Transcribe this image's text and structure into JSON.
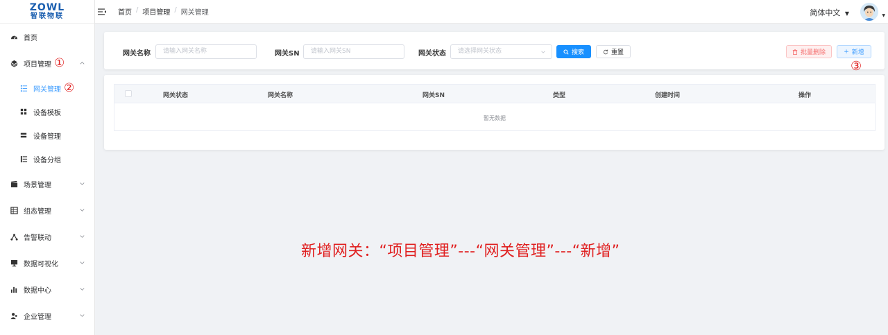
{
  "logo": {
    "main": "ZOWL",
    "sub": "智联物联"
  },
  "sidebar": {
    "items": [
      {
        "label": "首页",
        "icon": "dashboard-icon"
      },
      {
        "label": "项目管理",
        "icon": "layers-icon",
        "annotation": "①"
      },
      {
        "label": "网关管理",
        "icon": "list-icon",
        "annotation": "②"
      },
      {
        "label": "设备模板",
        "icon": "grid-icon"
      },
      {
        "label": "设备管理",
        "icon": "server-icon"
      },
      {
        "label": "设备分组",
        "icon": "group-icon"
      },
      {
        "label": "场景管理",
        "icon": "clapper-icon"
      },
      {
        "label": "组态管理",
        "icon": "table-icon"
      },
      {
        "label": "告警联动",
        "icon": "link-icon"
      },
      {
        "label": "数据可视化",
        "icon": "monitor-icon"
      },
      {
        "label": "数据中心",
        "icon": "bar-chart-icon"
      },
      {
        "label": "企业管理",
        "icon": "users-icon"
      }
    ]
  },
  "header": {
    "breadcrumb": [
      "首页",
      "项目管理",
      "网关管理"
    ],
    "separator": "/",
    "language": "简体中文"
  },
  "search": {
    "name_label": "网关名称",
    "name_placeholder": "请输入网关名称",
    "sn_label": "网关SN",
    "sn_placeholder": "请输入网关SN",
    "status_label": "网关状态",
    "status_placeholder": "请选择网关状态",
    "search_button": "搜索",
    "reset_button": "重置",
    "batch_delete_button": "批量删除",
    "add_button": "新增",
    "add_annotation": "③"
  },
  "table": {
    "columns": [
      "网关状态",
      "网关名称",
      "网关SN",
      "类型",
      "创建时间",
      "操作"
    ],
    "empty_text": "暂无数据"
  },
  "annotation": {
    "text": "新增网关：“项目管理”---“网关管理”---“新增”"
  },
  "colors": {
    "primary": "#1890ff",
    "active": "#409eff",
    "annotation": "#e02020",
    "danger": "#f56c6c"
  }
}
